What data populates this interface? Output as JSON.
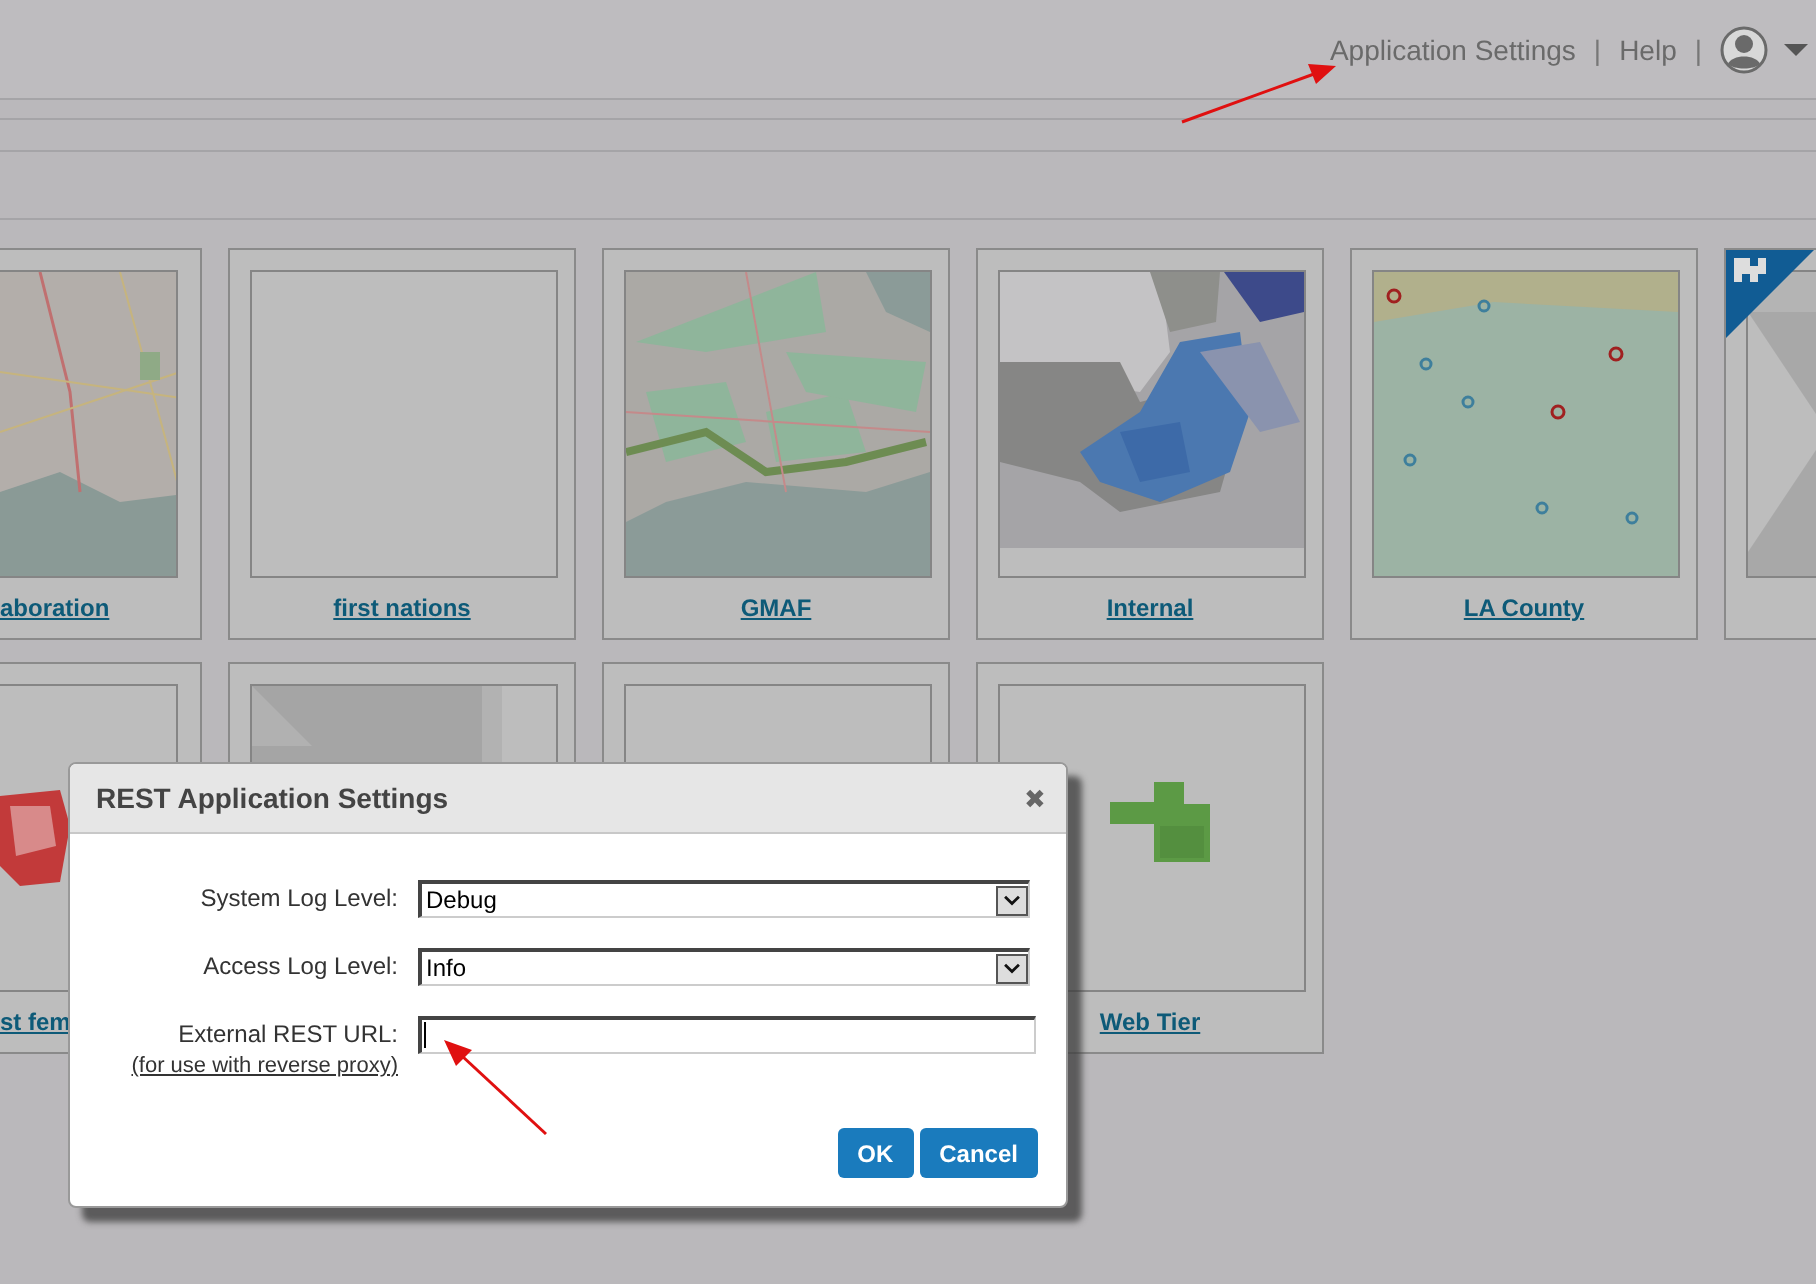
{
  "header": {
    "items": [
      {
        "kind": "link",
        "text": "Application Settings"
      },
      {
        "kind": "separator",
        "text": "|"
      },
      {
        "kind": "link",
        "text": "Help"
      },
      {
        "kind": "separator",
        "text": "|"
      }
    ]
  },
  "tiles": [
    [
      {
        "label": "aboration",
        "corner_badge": false
      },
      {
        "label": "first nations",
        "corner_badge": false
      },
      {
        "label": "GMAF",
        "corner_badge": false
      },
      {
        "label": "Internal",
        "corner_badge": false
      },
      {
        "label": "LA County",
        "corner_badge": false
      },
      {
        "corner_badge": true
      }
    ],
    [
      {
        "label": "st fem",
        "corner_badge": false
      },
      {
        "corner_badge": false
      },
      {
        "corner_badge": false
      },
      {
        "label": "Web Tier",
        "corner_badge": false
      }
    ]
  ],
  "dialog": {
    "title": "REST Application Settings",
    "close": "✖",
    "fields": [
      {
        "kind": "select",
        "label": "System Log Level:",
        "value": "Debug"
      },
      {
        "kind": "select",
        "label": "Access Log Level:",
        "value": "Info"
      },
      {
        "kind": "text",
        "label": "External REST URL:",
        "note": "(for use with reverse proxy)",
        "focused": true
      }
    ],
    "buttons": [
      "OK",
      "Cancel"
    ]
  }
}
